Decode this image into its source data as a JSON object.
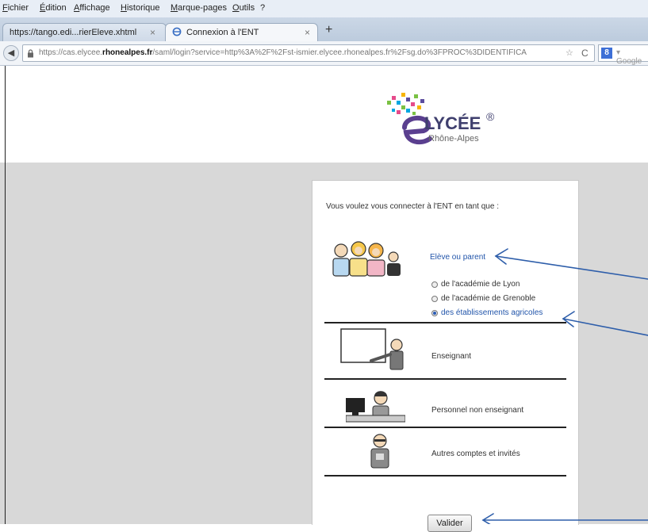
{
  "menu": [
    "Fichier",
    "Édition",
    "Affichage",
    "Historique",
    "Marque-pages",
    "Outils",
    "?"
  ],
  "tabs": [
    {
      "title": "https://tango.edi...rierEleve.xhtml",
      "close": "×",
      "active": false
    },
    {
      "title": "Connexion à l'ENT",
      "close": "×",
      "active": true
    }
  ],
  "new_tab": "+",
  "url": {
    "prefix": "https://cas.elycee.",
    "domain": "rhonealpes.fr",
    "path": "/saml/login?service=http%3A%2F%2Fst-ismier.elycee.rhonealpes.fr%2Fsg.do%3FPROC%3DIDENTIFICA",
    "bookmark_star": "☆",
    "reload": "C"
  },
  "search": {
    "engine_icon": "8",
    "placeholder": "▾ Google"
  },
  "logo": {
    "name": "LYCÉE",
    "region": "Rhône-Alpes",
    "mark": "®"
  },
  "login": {
    "intro": "Vous voulez vous connecter à l'ENT en tant que :",
    "roles": {
      "eleve": "Elève ou parent",
      "enseignant": "Enseignant",
      "personnel": "Personnel non enseignant",
      "autres": "Autres comptes et invités"
    },
    "academies": [
      {
        "label": "de l'académie de Lyon",
        "checked": false
      },
      {
        "label": "de l'académie de Grenoble",
        "checked": false
      },
      {
        "label": "des établissements agricoles",
        "checked": true
      }
    ],
    "submit": "Valider"
  },
  "colors": {
    "link": "#2255aa",
    "arrow": "#2e5eaa",
    "page_gray": "#d8d8d8"
  }
}
